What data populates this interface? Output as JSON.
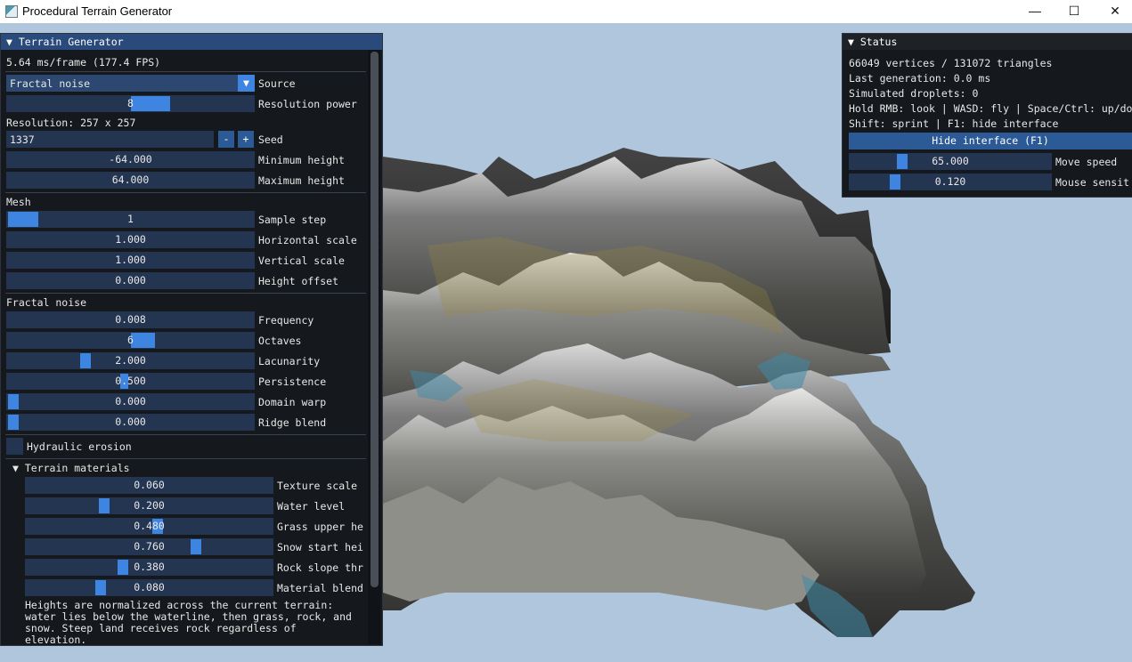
{
  "window": {
    "title": "Procedural Terrain Generator",
    "minimize": "—",
    "maximize": "☐",
    "close": "✕"
  },
  "left": {
    "header": "▼ Terrain Generator",
    "fps": "5.64 ms/frame (177.4 FPS)",
    "source": {
      "value": "Fractal noise",
      "label": "Source",
      "arrow": "▼"
    },
    "resolution_power": {
      "value": "8",
      "label": "Resolution power",
      "fill": 0.625
    },
    "resolution_text": "Resolution: 257 x 257",
    "seed": {
      "value": "1337",
      "label": "Seed",
      "minus": "-",
      "plus": "+"
    },
    "min_height": {
      "value": "-64.000",
      "label": "Minimum height"
    },
    "max_height": {
      "value": "64.000",
      "label": "Maximum height"
    },
    "mesh_title": "Mesh",
    "sample_step": {
      "value": "1",
      "label": "Sample step",
      "fill": 0.0
    },
    "horizontal_scale": {
      "value": "1.000",
      "label": "Horizontal scale"
    },
    "vertical_scale": {
      "value": "1.000",
      "label": "Vertical scale"
    },
    "height_offset": {
      "value": "0.000",
      "label": "Height offset"
    },
    "fractal_title": "Fractal noise",
    "frequency": {
      "value": "0.008",
      "label": "Frequency"
    },
    "octaves": {
      "value": "6",
      "label": "Octaves",
      "fill": 0.55
    },
    "lacunarity": {
      "value": "2.000",
      "label": "Lacunarity",
      "fill": 0.31
    },
    "persistence": {
      "value": "0.500",
      "label": "Persistence",
      "fill": 0.47
    },
    "domain_warp": {
      "value": "0.000",
      "label": "Domain warp",
      "fill": 0.0
    },
    "ridge_blend": {
      "value": "0.000",
      "label": "Ridge blend",
      "fill": 0.0
    },
    "hydraulic": {
      "label": "Hydraulic erosion"
    },
    "materials_title": "▼ Terrain materials",
    "texture_scale": {
      "value": "0.060",
      "label": "Texture scale"
    },
    "water_level": {
      "value": "0.200",
      "label": "Water level",
      "fill": 0.3
    },
    "grass_upper": {
      "value": "0.480",
      "label": "Grass upper he",
      "fill": 0.52
    },
    "snow_start": {
      "value": "0.760",
      "label": "Snow start hei",
      "fill": 0.7
    },
    "rock_slope": {
      "value": "0.380",
      "label": "Rock slope thr",
      "fill": 0.38
    },
    "material_blend": {
      "value": "0.080",
      "label": "Material blend",
      "fill": 0.3
    },
    "note_lines": [
      "Heights are normalized across the current terrain:",
      "water lies below the waterline, then grass, rock, and",
      "snow. Steep land receives rock regardless of",
      "elevation."
    ]
  },
  "status": {
    "header": "▼ Status",
    "lines": [
      "66049 vertices / 131072 triangles",
      "Last generation: 0.0 ms",
      "Simulated droplets: 0",
      "Hold RMB: look | WASD: fly | Space/Ctrl: up/do",
      "Shift: sprint | F1: hide interface"
    ],
    "hide_button": "Hide interface (F1)",
    "move_speed": {
      "value": "65.000",
      "label": "Move speed",
      "fill": 0.22
    },
    "mouse_sens": {
      "value": "0.120",
      "label": "Mouse sensit",
      "fill": 0.18
    }
  },
  "colors": {
    "accent": "#3d85e0",
    "field": "#243551",
    "header": "#294a7a",
    "sky": "#b0c6dd"
  }
}
